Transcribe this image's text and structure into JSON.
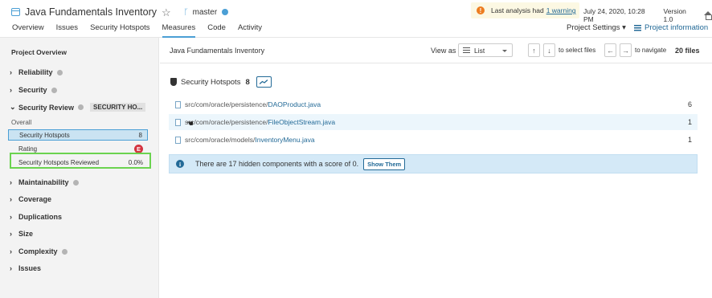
{
  "header": {
    "project_title": "Java Fundamentals Inventory",
    "branch": "master",
    "warning_text": "Last analysis had",
    "warning_link": "1 warning",
    "analysis_date": "July 24, 2020, 10:28 PM",
    "version": "Version 1.0",
    "project_settings": "Project Settings ▾",
    "project_information": "Project information"
  },
  "nav": {
    "tabs": [
      {
        "label": "Overview"
      },
      {
        "label": "Issues"
      },
      {
        "label": "Security Hotspots"
      },
      {
        "label": "Measures",
        "active": true
      },
      {
        "label": "Code"
      },
      {
        "label": "Activity"
      }
    ]
  },
  "sidebar": {
    "heading": "Project Overview",
    "reliability": "Reliability",
    "security": "Security",
    "security_review": "Security Review",
    "security_review_tag": "SECURITY HO...",
    "overall": "Overall",
    "rows": [
      {
        "label": "Security Hotspots",
        "value": "8"
      },
      {
        "label": "Rating",
        "value": "E"
      },
      {
        "label": "Security Hotspots Reviewed",
        "value": "0.0%"
      }
    ],
    "maintainability": "Maintainability",
    "coverage": "Coverage",
    "duplications": "Duplications",
    "size": "Size",
    "complexity": "Complexity",
    "issues": "Issues"
  },
  "main": {
    "breadcrumb": "Java Fundamentals Inventory",
    "view_as_label": "View as",
    "view_as_value": "List",
    "up_key": "↑",
    "down_key": "↓",
    "select_hint": "to select files",
    "left_key": "←",
    "right_key": "→",
    "navigate_hint": "to navigate",
    "files_count": "20 files",
    "measure_label": "Security Hotspots",
    "measure_value": "8",
    "files": [
      {
        "path": "src/com/oracle/persistence/",
        "name": "DAOProduct.java",
        "value": "6"
      },
      {
        "path": "src/com/oracle/persistence/",
        "name": "FileObjectStream.java",
        "value": "1"
      },
      {
        "path": "src/com/oracle/models/",
        "name": "InventoryMenu.java",
        "value": "1"
      }
    ],
    "hidden_info": "There are 17 hidden components with a score of 0.",
    "show_them": "Show Them"
  },
  "colors": {
    "accent": "#4b9fd5",
    "link": "#236a97",
    "rating_e": "#d4333f",
    "highlight_box": "#6bd34f"
  }
}
